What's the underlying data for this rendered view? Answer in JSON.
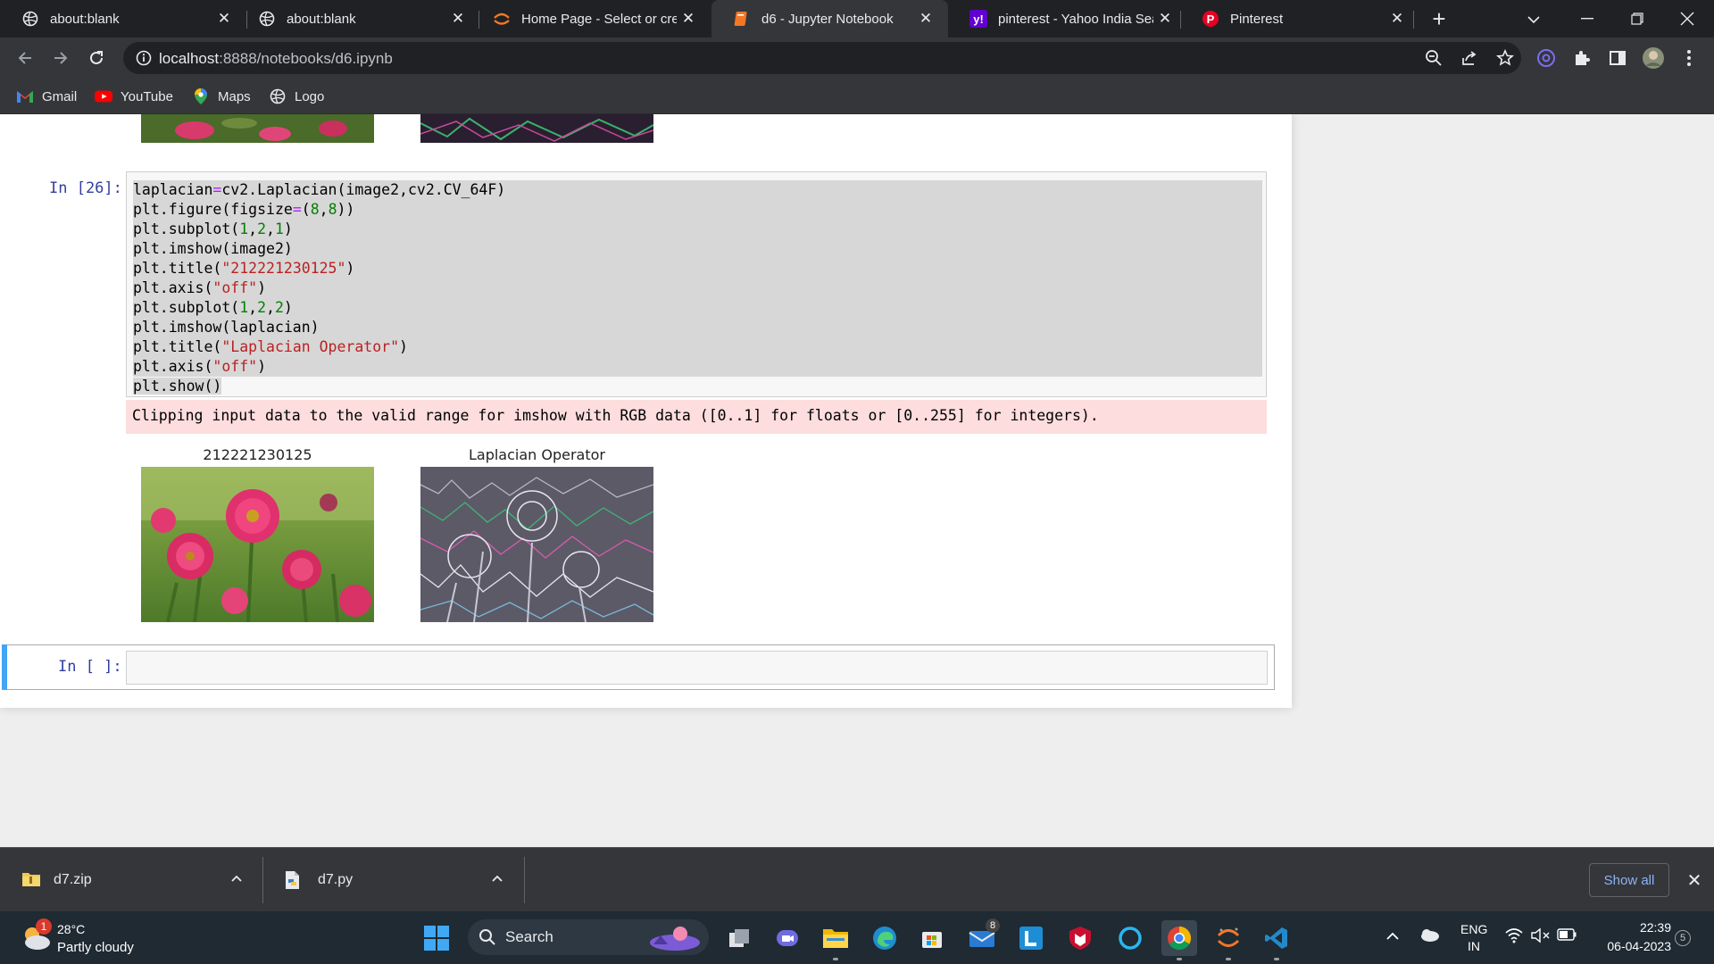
{
  "tabs": [
    {
      "title": "about:blank",
      "favicon": "globe-icon"
    },
    {
      "title": "about:blank",
      "favicon": "globe-icon"
    },
    {
      "title": "Home Page - Select or crea",
      "favicon": "jupyter-icon"
    },
    {
      "title": "d6 - Jupyter Notebook",
      "favicon": "notebook-icon"
    },
    {
      "title": "pinterest - Yahoo India Sea",
      "favicon": "yahoo-icon"
    },
    {
      "title": "Pinterest",
      "favicon": "pinterest-icon"
    }
  ],
  "address": {
    "host": "localhost",
    "rest": ":8888/notebooks/d6.ipynb"
  },
  "bookmarks": [
    {
      "label": "Gmail",
      "icon": "gmail-icon"
    },
    {
      "label": "YouTube",
      "icon": "youtube-icon"
    },
    {
      "label": "Maps",
      "icon": "maps-icon"
    },
    {
      "label": "Logo",
      "icon": "globe-icon"
    }
  ],
  "notebook": {
    "prompt_code": "In [26]:",
    "prompt_empty": "In [ ]:",
    "code_lines": [
      "laplacian=cv2.Laplacian(image2,cv2.CV_64F)",
      "plt.figure(figsize=(8,8))",
      "plt.subplot(1,2,1)",
      "plt.imshow(image2)",
      "plt.title(\"212221230125\")",
      "plt.axis(\"off\")",
      "plt.subplot(1,2,2)",
      "plt.imshow(laplacian)",
      "plt.title(\"Laplacian Operator\")",
      "plt.axis(\"off\")",
      "plt.show()"
    ],
    "stderr": "Clipping input data to the valid range for imshow with RGB data ([0..1] for floats or [0..255] for integers).",
    "plot_titles": [
      "212221230125",
      "Laplacian Operator"
    ]
  },
  "downloads": [
    {
      "name": "d7.zip",
      "icon": "zip-file-icon"
    },
    {
      "name": "d7.py",
      "icon": "python-file-icon"
    }
  ],
  "show_all_label": "Show all",
  "taskbar": {
    "weather_temp": "28°C",
    "weather_desc": "Partly cloudy",
    "weather_badge": "1",
    "search_label": "Search",
    "mail_badge": "8",
    "lang_top": "ENG",
    "lang_bottom": "IN",
    "time": "22:39",
    "date": "06-04-2023",
    "notif_count": "5"
  },
  "colors": {
    "accent": "#42a5f5",
    "prompt": "#303f9f",
    "stderr_bg": "#fddddd",
    "string": "#ba2121",
    "number": "#008000"
  }
}
